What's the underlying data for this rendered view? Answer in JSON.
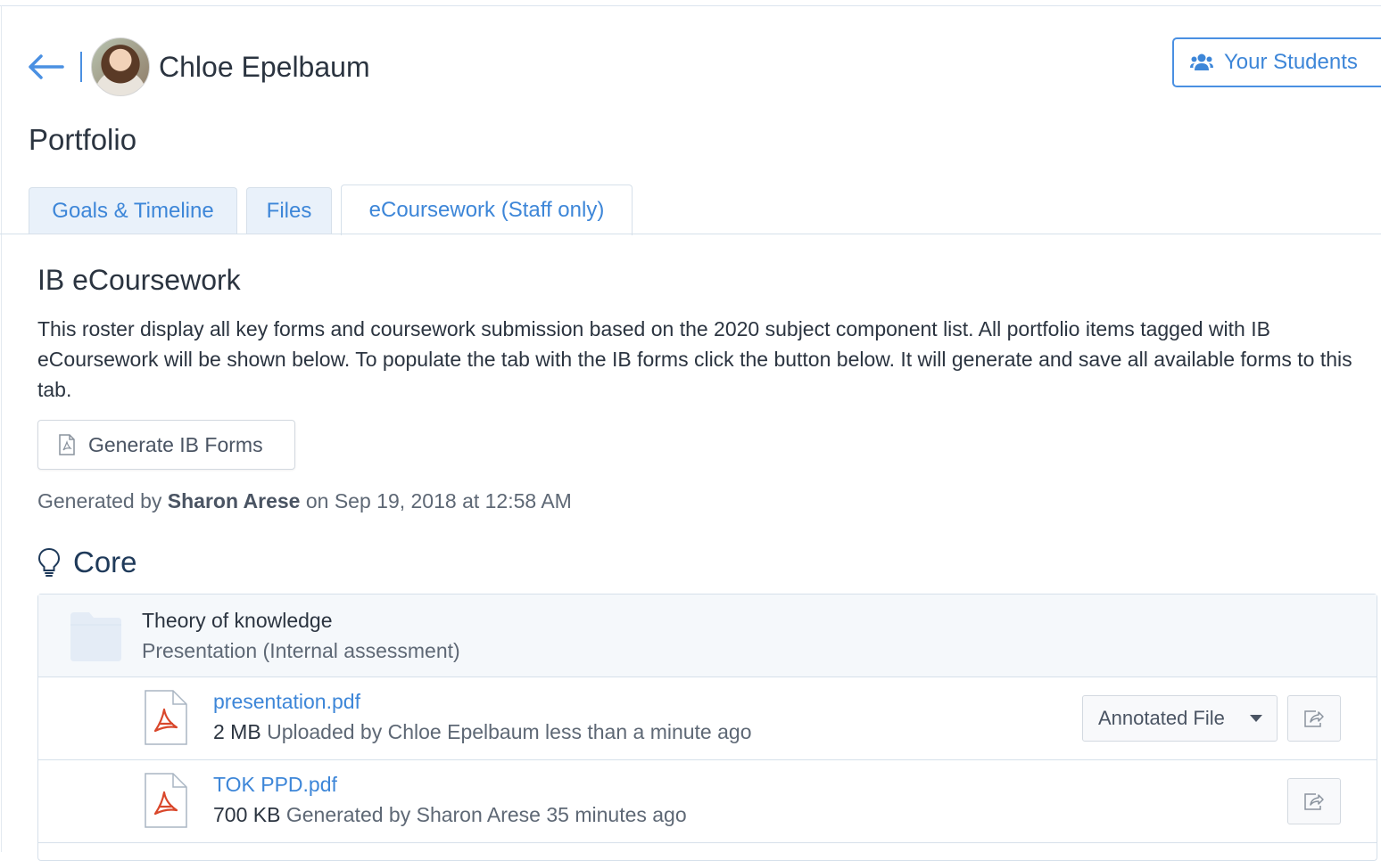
{
  "header": {
    "student_name": "Chloe Epelbaum",
    "your_students_label": "Your Students"
  },
  "page": {
    "title": "Portfolio"
  },
  "tabs": [
    {
      "label": "Goals & Timeline",
      "active": false
    },
    {
      "label": "Files",
      "active": false
    },
    {
      "label": "eCoursework (Staff only)",
      "active": true
    }
  ],
  "ecoursework": {
    "title": "IB eCoursework",
    "description": "This roster display all key forms and coursework submission based on the 2020 subject component list. All portfolio items tagged with IB eCoursework will be shown below. To populate the tab with the IB forms click the button below. It will generate and save all available forms to this tab.",
    "generate_button_label": "Generate IB Forms",
    "generated_prefix": "Generated by",
    "generated_by": "Sharon Arese",
    "generated_on": "on Sep 19, 2018 at 12:58 AM"
  },
  "core": {
    "heading": "Core",
    "subject": "Theory of knowledge",
    "component": "Presentation (Internal assessment)",
    "files": [
      {
        "name": "presentation.pdf",
        "size": "2 MB",
        "meta": "Uploaded by Chloe Epelbaum less than a minute ago",
        "type_button": "Annotated File"
      },
      {
        "name": "TOK PPD.pdf",
        "size": "700 KB",
        "meta": "Generated by Sharon Arese 35 minutes ago"
      }
    ]
  },
  "colors": {
    "accent": "#4a90e2",
    "link": "#3d86d8",
    "text": "#2b3440",
    "muted": "#5e6875",
    "pdf": "#d9472b"
  }
}
